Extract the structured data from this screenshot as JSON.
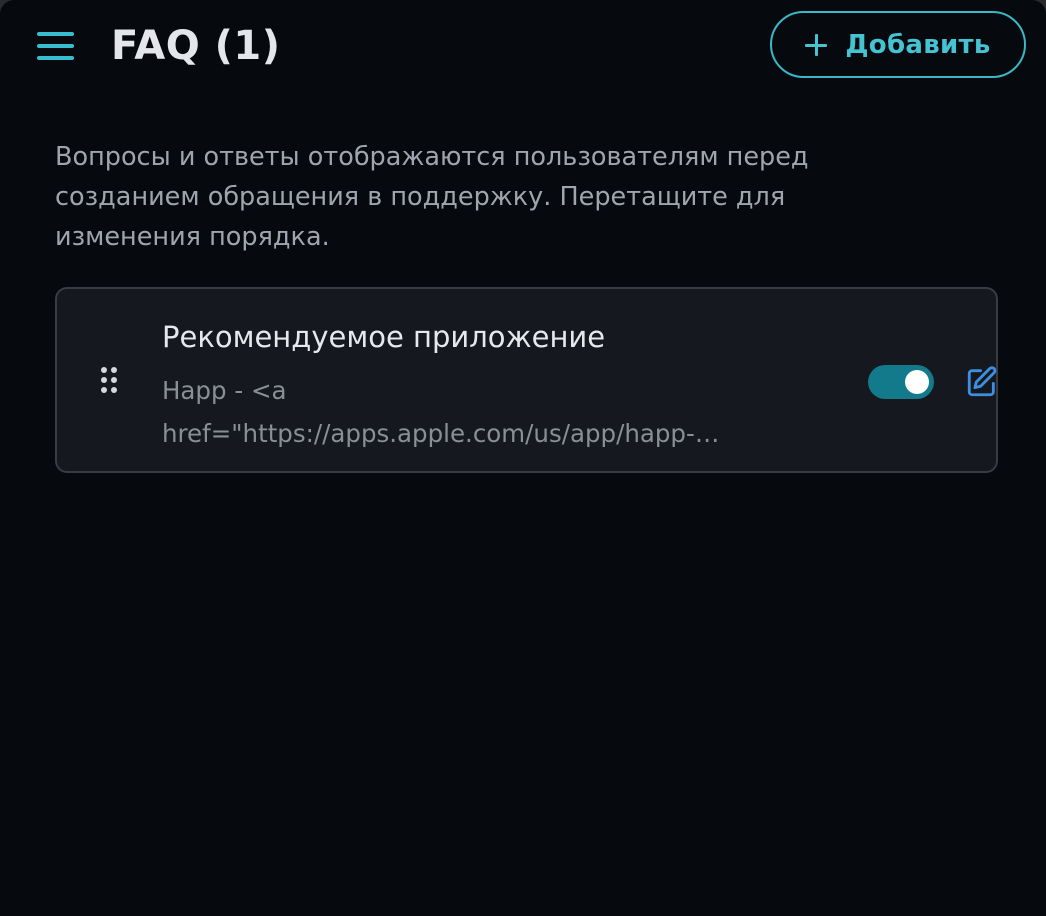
{
  "header": {
    "title": "FAQ (1)",
    "menu_icon": "hamburger-menu-icon",
    "add_button_label": "Добавить",
    "add_icon": "plus-icon"
  },
  "description": "Вопросы и ответы отображаются пользователям перед созданием обращения в поддержку. Перетащите для изменения порядка.",
  "faq_items": [
    {
      "question": "Рекомендуемое приложение",
      "answer_preview": "Happ - <a\nhref=\"https://apps.apple.com/us/app/happ-…",
      "enabled": true,
      "drag_icon": "drag-handle-icon",
      "edit_icon": "edit-pencil-icon"
    }
  ],
  "colors": {
    "background": "#06090d",
    "accent": "#45c3d3",
    "card": "#15191f",
    "toggle_on": "#127a8a",
    "edit_icon": "#3d8fe0"
  }
}
